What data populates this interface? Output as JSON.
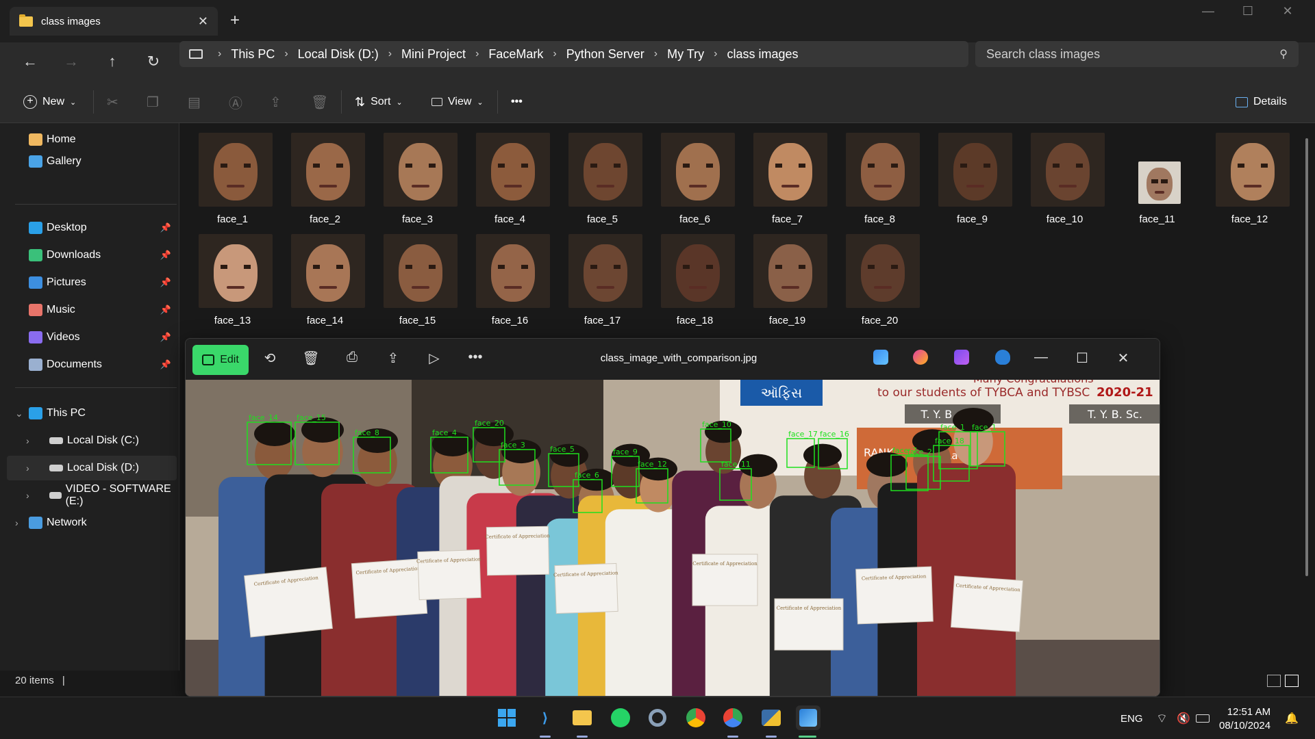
{
  "window": {
    "tab_title": "class images",
    "new_tab": "+",
    "minimize": "—",
    "maximize": "☐",
    "close": "✕"
  },
  "address": {
    "crumbs": [
      "This PC",
      "Local Disk (D:)",
      "Mini Project",
      "FaceMark",
      "Python Server",
      "My Try",
      "class images"
    ],
    "search_placeholder": "Search class images"
  },
  "commandbar": {
    "new_label": "New",
    "sort_label": "Sort",
    "view_label": "View",
    "more_label": "•••",
    "details_label": "Details"
  },
  "sidebar": {
    "quick": [
      {
        "label": "Home",
        "icon": "home-icon",
        "color": "#f0b860"
      },
      {
        "label": "Gallery",
        "icon": "gallery-icon",
        "color": "#4aa3e6"
      }
    ],
    "pinned": [
      {
        "label": "Desktop",
        "icon": "desktop-icon",
        "color": "#2aa0e8"
      },
      {
        "label": "Downloads",
        "icon": "downloads-icon",
        "color": "#3ac07a"
      },
      {
        "label": "Pictures",
        "icon": "pictures-icon",
        "color": "#3d8fe0"
      },
      {
        "label": "Music",
        "icon": "music-icon",
        "color": "#e8746a"
      },
      {
        "label": "Videos",
        "icon": "videos-icon",
        "color": "#8a6cf0"
      },
      {
        "label": "Documents",
        "icon": "documents-icon",
        "color": "#9ab0d0"
      }
    ],
    "tree": [
      {
        "label": "This PC",
        "icon": "pc-icon",
        "expanded": true
      },
      {
        "label": "Local Disk (C:)",
        "icon": "drive-icon"
      },
      {
        "label": "Local Disk (D:)",
        "icon": "drive-icon",
        "selected": true
      },
      {
        "label": "VIDEO - SOFTWARE (E:)",
        "icon": "drive-icon"
      },
      {
        "label": "Network",
        "icon": "network-icon"
      }
    ]
  },
  "files": [
    {
      "name": "face_1",
      "skin": "#8a5a3c"
    },
    {
      "name": "face_2",
      "skin": "#9a6848"
    },
    {
      "name": "face_3",
      "skin": "#a77856"
    },
    {
      "name": "face_4",
      "skin": "#8c5b3c"
    },
    {
      "name": "face_5",
      "skin": "#6e4630"
    },
    {
      "name": "face_6",
      "skin": "#a0704e"
    },
    {
      "name": "face_7",
      "skin": "#c08a62"
    },
    {
      "name": "face_8",
      "skin": "#8e5e42"
    },
    {
      "name": "face_9",
      "skin": "#5c3a28"
    },
    {
      "name": "face_10",
      "skin": "#6a4430"
    },
    {
      "name": "face_11",
      "skin": "#a07860",
      "small": true
    },
    {
      "name": "face_12",
      "skin": "#b0805c"
    },
    {
      "name": "face_13",
      "skin": "#c8987a"
    },
    {
      "name": "face_14",
      "skin": "#a87656"
    },
    {
      "name": "face_15",
      "skin": "#8a5c40"
    },
    {
      "name": "face_16",
      "skin": "#946448"
    },
    {
      "name": "face_17",
      "skin": "#6c4632"
    },
    {
      "name": "face_18",
      "skin": "#5a3628"
    },
    {
      "name": "face_19",
      "skin": "#8a6048"
    },
    {
      "name": "face_20",
      "skin": "#5e3c2c"
    }
  ],
  "status": {
    "items": "20 items"
  },
  "viewer": {
    "edit_label": "Edit",
    "title": "class_image_with_comparison.jpg",
    "banner_line1": "Many Congratulations",
    "banner_line2": "to our students of TYBCA and TYBSC",
    "banner_year": "2020-21",
    "sign1": "T. Y. B. C. A.",
    "sign2": "T. Y. B. Sc.",
    "office_sign": "ઑફિસ",
    "rank_text": "RANK",
    "lad_text": "Lad",
    "cert_title": "Certificate of Appreciation",
    "face_labels": [
      "face_14",
      "face_15",
      "face_8",
      "face_4",
      "face_20",
      "face_3",
      "face_5",
      "face_6",
      "face_9",
      "face_12",
      "face_10",
      "face_11",
      "face_17",
      "face_16",
      "face_7",
      "face_18",
      "face_2",
      "face_1",
      "face_1"
    ]
  },
  "taskbar": {
    "lang": "ENG",
    "time": "12:51 AM",
    "date": "08/10/2024"
  }
}
